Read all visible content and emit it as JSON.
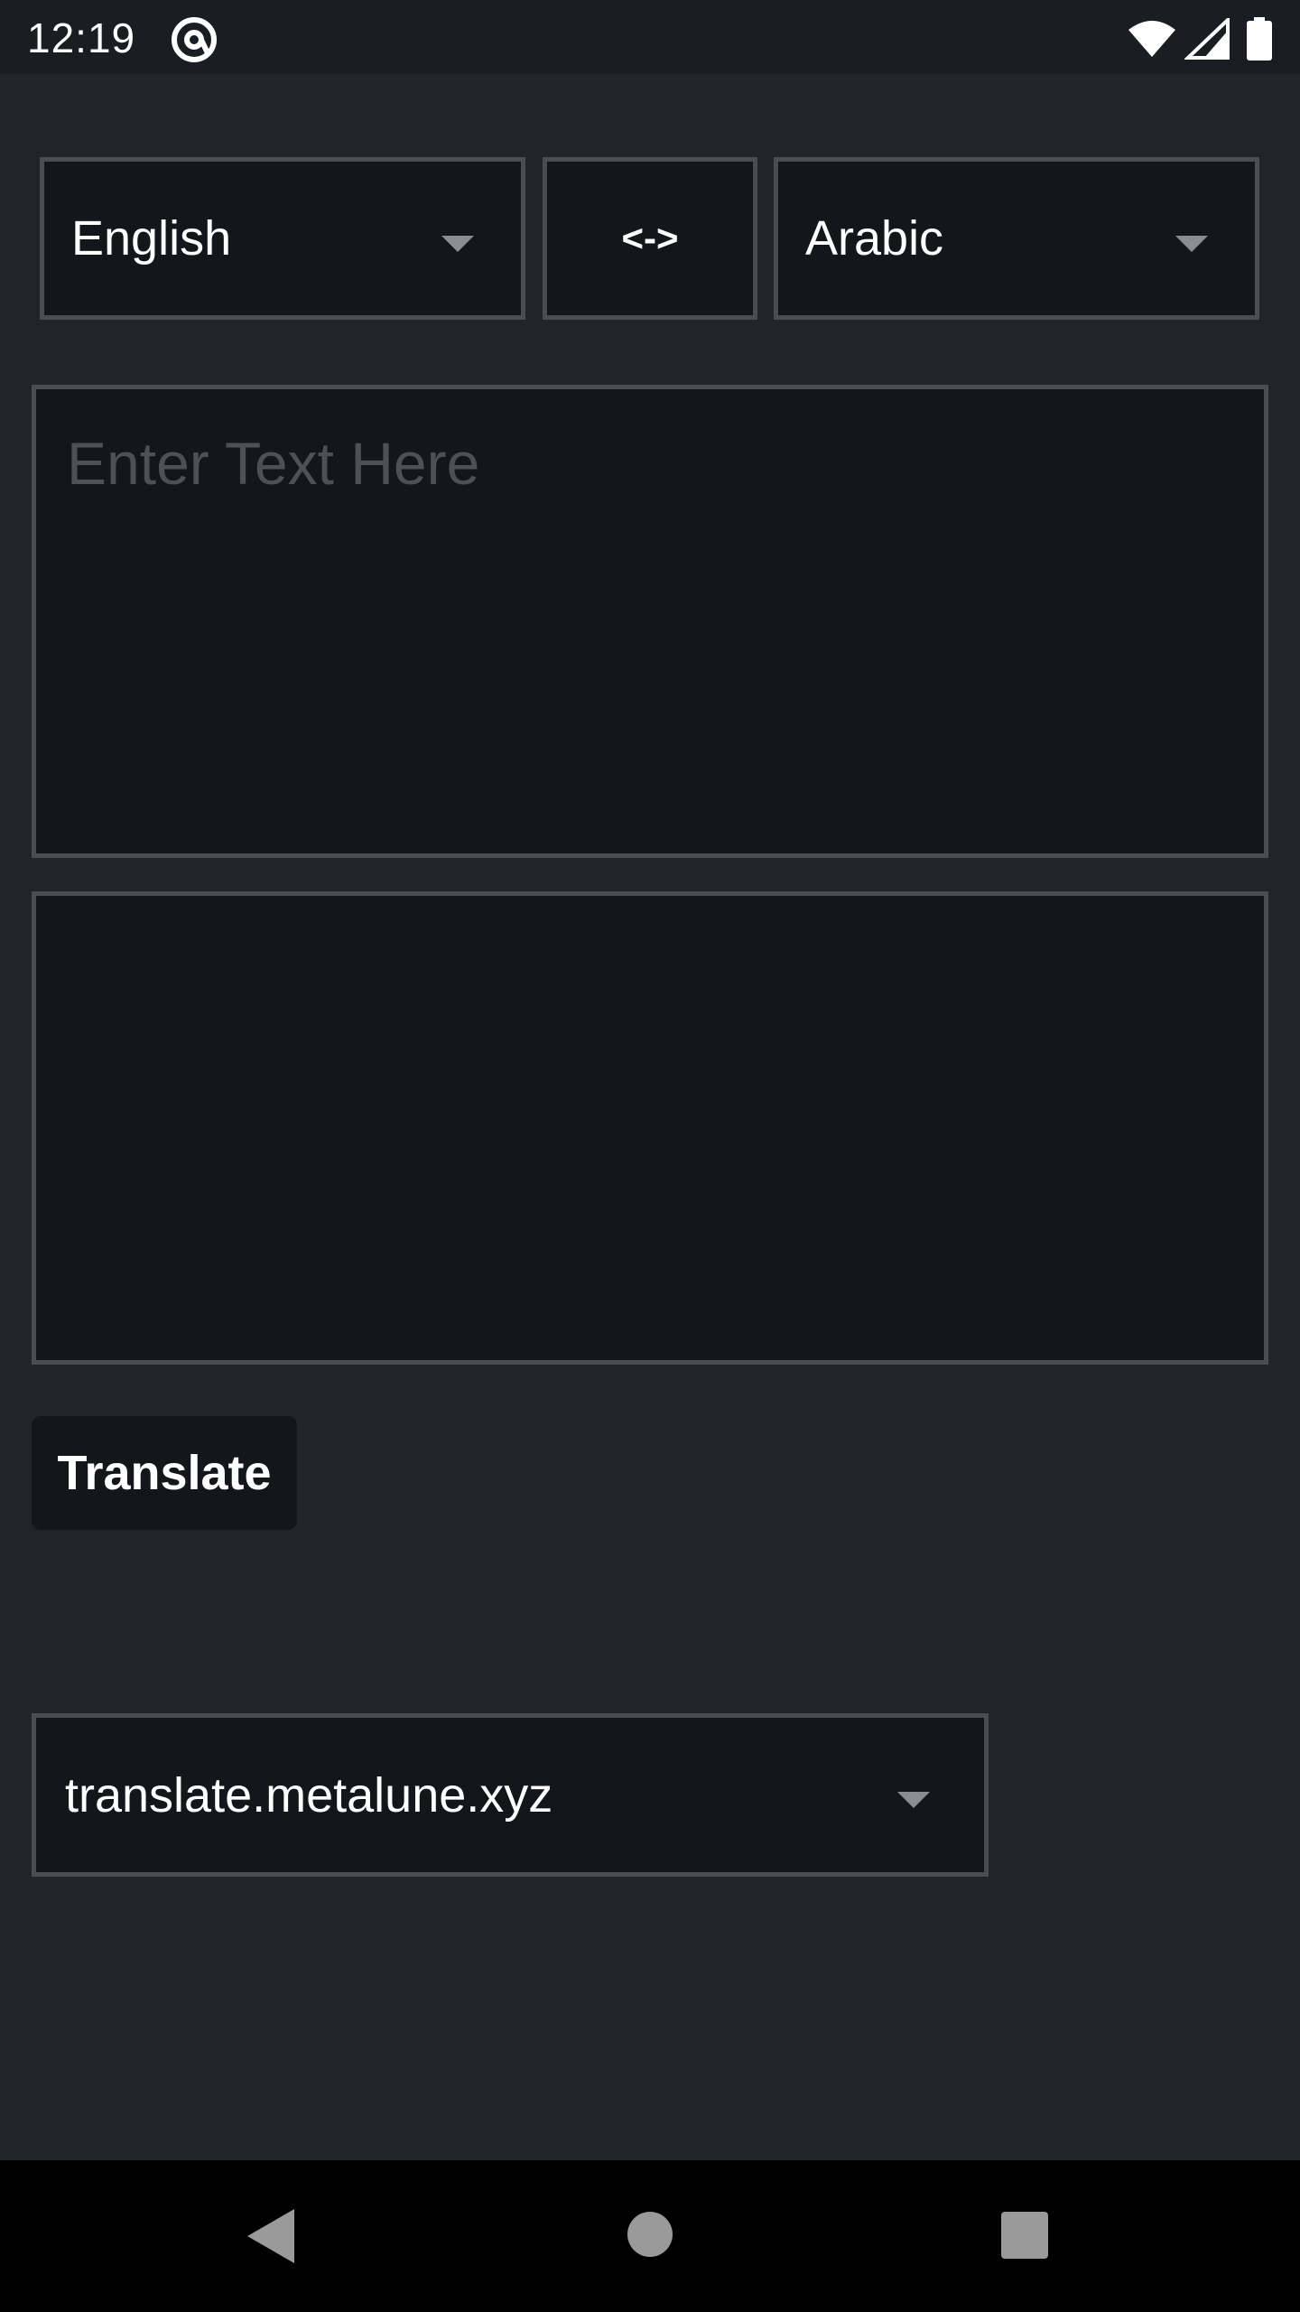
{
  "status_bar": {
    "time": "12:19",
    "app_icon": "at-sign-icon",
    "wifi_icon": "wifi-icon",
    "signal_icon": "signal-icon",
    "battery_icon": "battery-icon"
  },
  "translator": {
    "source_language": "English",
    "swap_label": "<->",
    "target_language": "Arabic",
    "input_placeholder": "Enter Text Here",
    "input_value": "",
    "output_value": "",
    "translate_label": "Translate",
    "server": "translate.metalune.xyz"
  },
  "nav_bar": {
    "back_icon": "back-triangle-icon",
    "home_icon": "home-circle-icon",
    "recents_icon": "recents-square-icon"
  },
  "colors": {
    "background": "#212429",
    "field_background": "#13161a",
    "border": "#4a4e54",
    "placeholder": "#4d5157"
  }
}
